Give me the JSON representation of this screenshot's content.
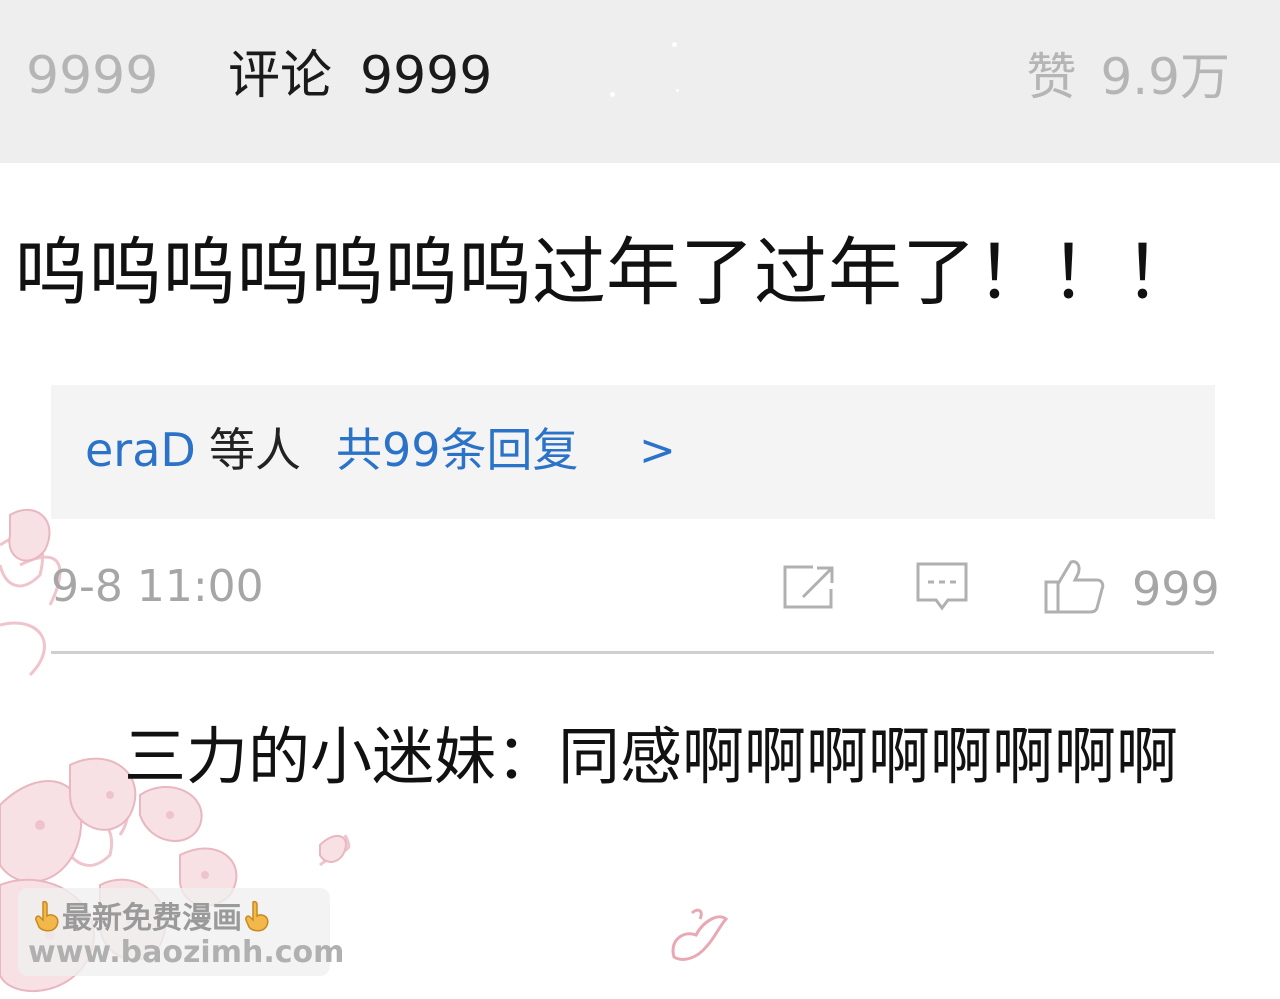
{
  "top_bar": {
    "left_count": "9999",
    "comments_label": "评论",
    "comments_count": "9999",
    "likes_label": "赞",
    "likes_count": "9.9万"
  },
  "comment": {
    "text": "呜呜呜呜呜呜呜过年了过年了！！！",
    "replies": {
      "user": "eraD",
      "etc_label": "等人",
      "total_label": "共99条回复",
      "chevron": ">"
    },
    "meta": {
      "date": "9-8 11:00",
      "like_count": "999"
    }
  },
  "sub_reply": {
    "user": "三力的小迷妹：",
    "text": "同感啊啊啊啊啊啊啊啊"
  },
  "watermark": {
    "line1": "最新免费漫画",
    "line2": "www.baozimh.com"
  },
  "icons": [
    "share-icon",
    "reply-icon",
    "thumbs-up-icon",
    "pointing-down-icon"
  ],
  "colors": {
    "link_blue": "#2b73c8",
    "muted_gray": "#a6a6a6",
    "top_bar_bg": "#eeeeee",
    "reply_box_bg": "#f4f4f4"
  }
}
